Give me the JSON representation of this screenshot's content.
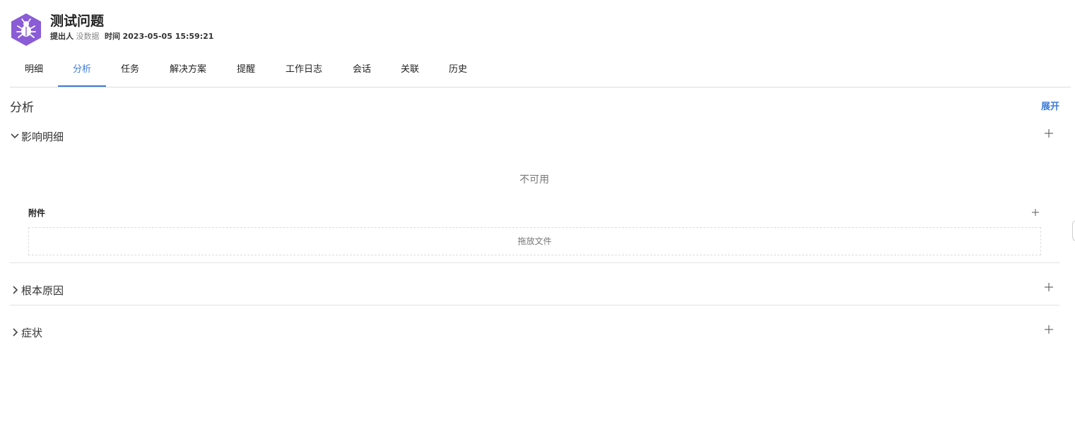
{
  "header": {
    "title": "测试问题",
    "icon": "bug-icon",
    "accent_color": "#8a5cd6",
    "submitter_label": "提出人",
    "submitter_value": "没数据",
    "time_label": "时间",
    "time_value": "2023-05-05 15:59:21"
  },
  "tabs": [
    {
      "label": "明细"
    },
    {
      "label": "分析",
      "active": true
    },
    {
      "label": "任务"
    },
    {
      "label": "解决方案"
    },
    {
      "label": "提醒"
    },
    {
      "label": "工作日志"
    },
    {
      "label": "会话"
    },
    {
      "label": "关联"
    },
    {
      "label": "历史"
    }
  ],
  "analysis": {
    "title": "分析",
    "expand_label": "展开",
    "groups": [
      {
        "label": "影响明细",
        "expanded": true
      },
      {
        "label": "根本原因",
        "expanded": false
      },
      {
        "label": "症状",
        "expanded": false
      }
    ],
    "unavailable_text": "不可用",
    "attachments_label": "附件",
    "dropzone_text": "拖放文件"
  },
  "colors": {
    "accent": "#3d7bd9",
    "icon_bg": "#8a5cd6"
  }
}
